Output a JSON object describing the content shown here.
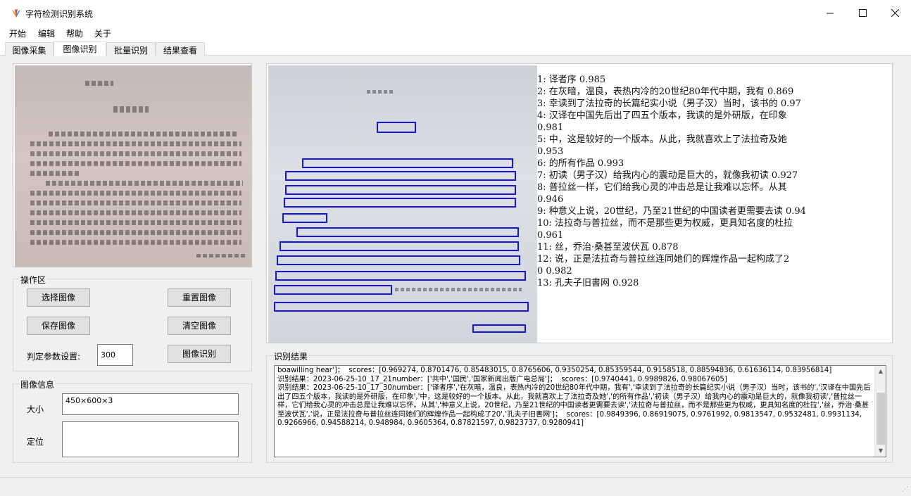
{
  "window": {
    "title": "字符检测识别系统",
    "minimize_icon": "minimize-icon",
    "maximize_icon": "maximize-icon",
    "close_icon": "close-icon"
  },
  "menu": [
    "开始",
    "编辑",
    "帮助",
    "关于"
  ],
  "tabs": [
    "图像采集",
    "图像识别",
    "批量识别",
    "结果查看"
  ],
  "active_tab": "图像识别",
  "operations": {
    "title": "操作区",
    "select_image": "选择图像",
    "reset_image": "重置图像",
    "save_image": "保存图像",
    "clear_image": "清空图像",
    "param_label": "判定参数设置:",
    "param_value": "300",
    "recognize": "图像识别"
  },
  "image_info": {
    "title": "图像信息",
    "size_label": "大小",
    "size_value": "450×600×3",
    "position_label": "定位",
    "position_value": ""
  },
  "ocr_lines": [
    "1:  译者序    0.985",
    "2:  在灰暗，温良，表热内冷的20世纪80年代中期，我有    0.869",
    "3:  幸读到了法拉奇的长篇纪实小说（男子汉）当时，该书的    0.97",
    "4:  汉译在中国先后出了四五个版本，我读的是外研版，在印象",
    "      0.981",
    "5:  中，这是较好的一个版本。从此，我就喜欢上了法拉奇及她",
    "      0.953",
    "6:  的所有作品    0.993",
    "7:  初读（男子汉）给我内心的震动是巨大的，就像我初读    0.927",
    "8:  普拉丝一样，它们给我心灵的冲击总是让我难以忘怀。从其",
    "      0.946",
    "9:  种意义上说，20世纪，乃至21世纪的中国读者更需要去读    0.94",
    "10:  法拉奇与普拉丝，而不是那些更为权威，更具知名度的杜拉",
    "      0.961",
    "11:  丝，乔治·桑甚至波伏瓦    0.878",
    "12:  说，正是法拉奇与普拉丝连同她们的辉煌作品一起构成了2",
    "    0  0.982",
    "13:  孔夫子旧書网    0.928"
  ],
  "result": {
    "title": "识别结果",
    "log": "boawilling hear']；  scores：[0.969274, 0.8701476, 0.85483015, 0.8765606, 0.9350254, 0.85359544, 0.9158518, 0.88594836, 0.61636114, 0.83956814]\n识别结果：2023-06-25-10_17_21number：['共中','国民','国家新闻出版广电总局']；  scores：[0.9740441, 0.9989826, 0.98067605]\n识别结果：2023-06-25-10_17_30number：['译者序','在灰暗，温良，表热内冷的20世纪80年代中期，我有','幸读到了法拉奇的长篇纪实小说（男子汉）当时，该书的','汉译在中国先后出了四五个版本，我读的是外研版，在印象','中，这是较好的一个版本。从此，我就喜欢上了法拉奇及她','的所有作品','初读（男子汉）给我内心的震动是巨大的，就像我初读','普拉丝一样，它们给我心灵的冲击总是让我难以忘怀。从其','种意义上说，20世纪，乃至21世纪的中国读者更需要去读','法拉奇与普拉丝，而不是那些更为权威，更具知名度的杜拉','丝，乔治·桑甚至波伏瓦','说，正是法拉奇与普拉丝连同她们的辉煌作品一起构成了20','孔夫子旧書网']；  scores：[0.9849396, 0.86919075, 0.9761992, 0.9813547, 0.9532481, 0.9931134, 0.9266966, 0.94588214, 0.948984, 0.9605364, 0.87821597, 0.9823737, 0.9280941]"
  },
  "colors": {
    "detection_box": "#1515d6",
    "window_bg": "#f0f0f0"
  }
}
